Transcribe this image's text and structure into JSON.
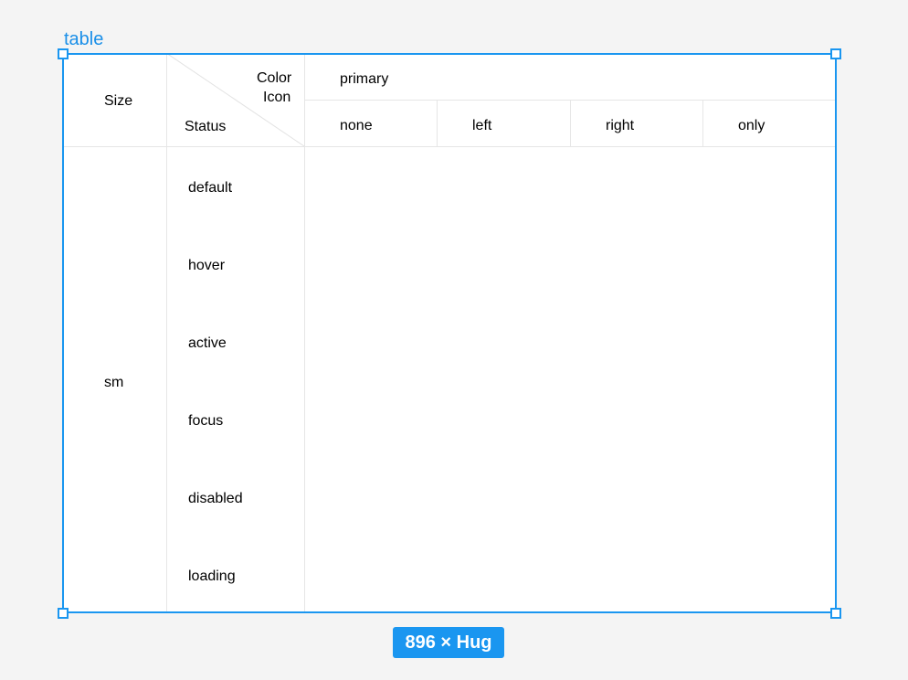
{
  "frame": {
    "label": "table",
    "size_badge": "896 × Hug"
  },
  "table": {
    "header": {
      "size": "Size",
      "color": "Color",
      "icon": "Icon",
      "status": "Status",
      "color_value": "primary",
      "icon_options": [
        "none",
        "left",
        "right",
        "only"
      ]
    },
    "size_value": "sm",
    "statuses": [
      "default",
      "hover",
      "active",
      "focus",
      "disabled",
      "loading"
    ]
  },
  "colors": {
    "accent": "#1a96f0",
    "border": "#e6e6e6",
    "canvas": "#f4f4f4"
  }
}
